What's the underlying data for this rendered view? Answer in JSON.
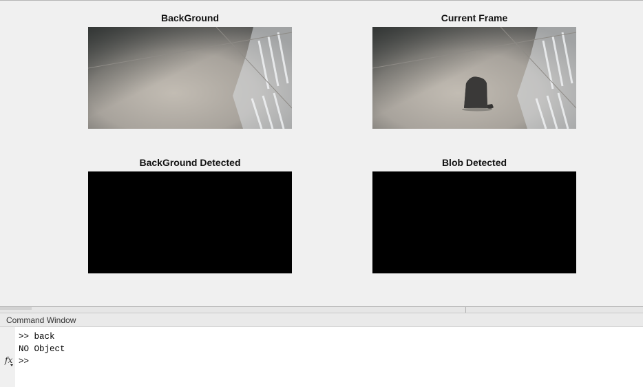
{
  "figure": {
    "panels": [
      {
        "title": "BackGround",
        "image": "empty-floor-scene"
      },
      {
        "title": "Current Frame",
        "image": "floor-scene-with-dark-object"
      },
      {
        "title": "BackGround Detected",
        "image": "black"
      },
      {
        "title": "Blob Detected",
        "image": "black"
      }
    ]
  },
  "command_window": {
    "title": "Command Window",
    "lines": [
      ">> back",
      "NO Object",
      ">>"
    ],
    "fx_icon": "fx-function-browser-icon"
  },
  "colors": {
    "figure_bg": "#f0f0f0",
    "image_black": "#000000",
    "command_bg": "#ffffff"
  }
}
